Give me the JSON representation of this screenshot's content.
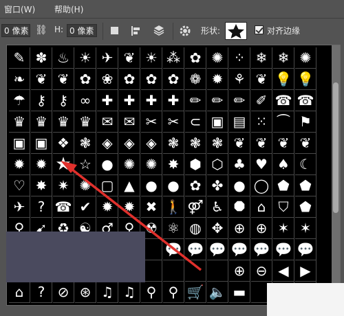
{
  "menu": {
    "window": "窗口(W)",
    "help": "帮助(H)"
  },
  "options": {
    "w_value": "0 像素",
    "link_icon": "link-icon",
    "h_label": "H:",
    "h_value": "0 像素",
    "shape_label": "形状:",
    "align_label": "对齐边缘",
    "align_checked": true
  },
  "colors": {
    "toolbar": "#535353",
    "grid_bg": "#000000",
    "arrow": "#e0302c"
  },
  "shapes": {
    "rows": [
      [
        "scribble",
        "paw",
        "flame",
        "sun",
        "bird",
        "leaf",
        "sun",
        "grass",
        "flower",
        "sunburst",
        "scatter",
        "snowflake",
        "snowflake",
        "spiral"
      ],
      [
        "maple-leaf",
        "leaf",
        "leaf",
        "flower",
        "flowers",
        "flower",
        "flower",
        "flower",
        "blossom",
        "splatter",
        "plant",
        "leaves",
        "bulb",
        "bulb"
      ],
      [
        "umbrella",
        "key",
        "key",
        "bow",
        "puzzle",
        "puzzle",
        "puzzle",
        "puzzle",
        "pencil",
        "pencil",
        "pencil",
        "brush",
        "phone",
        "phone"
      ],
      [
        "crown",
        "crown",
        "crown",
        "crown",
        "envelope",
        "envelope",
        "scissors",
        "scissors",
        "paperclip",
        "stamp",
        "note",
        "dots",
        "bat",
        "flag"
      ],
      [
        "frame",
        "frame",
        "diamond-tile",
        "ornament",
        "tile",
        "tile",
        "tile",
        "ornament",
        "ornament",
        "ornament",
        "flourish",
        "flourish",
        "flourish",
        "flourish"
      ],
      [
        "burst",
        "burst",
        "star",
        "star-outline",
        "blob",
        "seal",
        "seal",
        "badge",
        "hexagon",
        "hexagon-outline",
        "club",
        "heart",
        "spade",
        "moon"
      ],
      [
        "heart-outline",
        "badge",
        "seal-outline",
        "seal",
        "square-outline",
        "triangle",
        "blob",
        "blob",
        "flower",
        "clover",
        "circle",
        "ring",
        "pentagon",
        "pentagon"
      ],
      [
        "airplane",
        "question",
        "phone",
        "check",
        "burst",
        "burst",
        "cross",
        "walker",
        "couple",
        "wheelchair",
        "octagon",
        "house",
        "shield",
        "sign"
      ],
      [
        "bike",
        "cursor",
        "recycle",
        "yin-yang",
        "male",
        "female",
        "radiation",
        "atom",
        "globe",
        "compass",
        "crosshair",
        "crosshair",
        "splat",
        "splat"
      ],
      [
        "",
        "",
        "",
        "",
        "",
        "",
        "",
        "speech",
        "speech",
        "speech",
        "speech",
        "speech",
        "speech",
        "speech"
      ],
      [
        "",
        "",
        "",
        "",
        "",
        "",
        "",
        "",
        "",
        "",
        "plus",
        "minus",
        "arrow-left",
        "arrow-right"
      ],
      [
        "home",
        "question",
        "no",
        "film",
        "music",
        "music",
        "search",
        "search",
        "cart",
        "speaker",
        "dash",
        "",
        "",
        ""
      ]
    ]
  }
}
